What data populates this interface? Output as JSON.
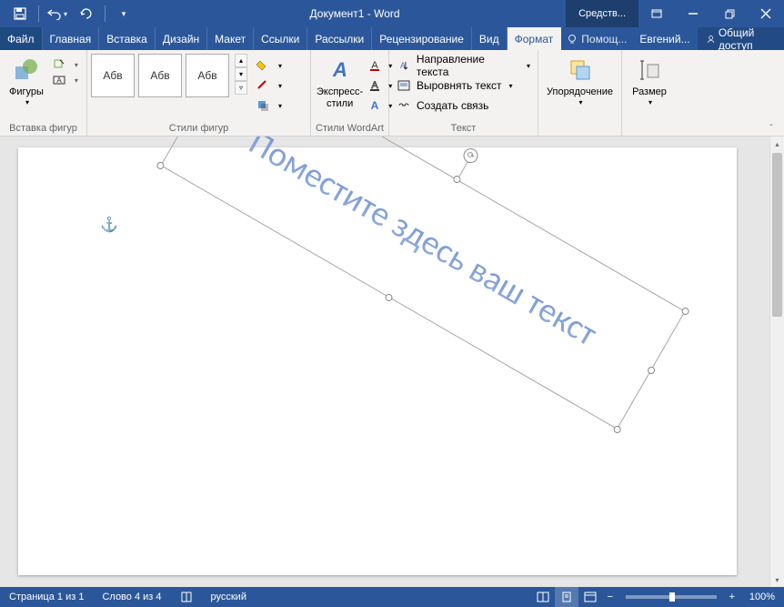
{
  "title": "Документ1 - Word",
  "tool_tab": "Средств...",
  "qat": {
    "customize": "▾"
  },
  "window": {
    "user": "Евгений..."
  },
  "menu": {
    "file": "Файл",
    "home": "Главная",
    "insert": "Вставка",
    "design": "Дизайн",
    "layout": "Макет",
    "references": "Ссылки",
    "mailings": "Рассылки",
    "review": "Рецензирование",
    "view": "Вид",
    "format": "Формат",
    "help_placeholder": "Помощ...",
    "share": "Общий доступ"
  },
  "ribbon": {
    "shapes": {
      "btn": "Фигуры",
      "group": "Вставка фигур"
    },
    "shape_styles": {
      "sample": "Абв",
      "group": "Стили фигур"
    },
    "wordart": {
      "btn": "Экспресс-\nстили",
      "group": "Стили WordArt"
    },
    "text": {
      "direction": "Направление текста",
      "align": "Выровнять текст",
      "link": "Создать связь",
      "group": "Текст"
    },
    "arrange": {
      "btn": "Упорядочение"
    },
    "size": {
      "btn": "Размер"
    }
  },
  "document": {
    "wordart_text": "Поместите здесь ваш текст"
  },
  "statusbar": {
    "page": "Страница 1 из 1",
    "words": "Слово 4 из 4",
    "lang": "русский",
    "zoom": "100%"
  }
}
